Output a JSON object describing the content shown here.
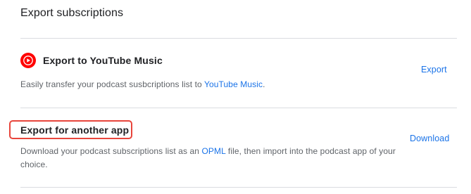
{
  "section_title": "Export subscriptions",
  "youtube_music": {
    "icon": "youtube-music-icon",
    "title": "Export to YouTube Music",
    "desc_prefix": "Easily transfer your podcast susbcriptions list to ",
    "desc_link": "YouTube Music",
    "desc_suffix": ".",
    "action_label": "Export"
  },
  "another_app": {
    "title": "Export for another app",
    "desc_prefix": "Download your podcast subscriptions list as an ",
    "desc_link": "OPML",
    "desc_suffix": " file, then import into the podcast app of your choice.",
    "action_label": "Download"
  },
  "colors": {
    "accent": "#1a73e8",
    "youtube_red": "#ff0000",
    "highlight": "#e8453c",
    "divider": "#dadce0"
  }
}
